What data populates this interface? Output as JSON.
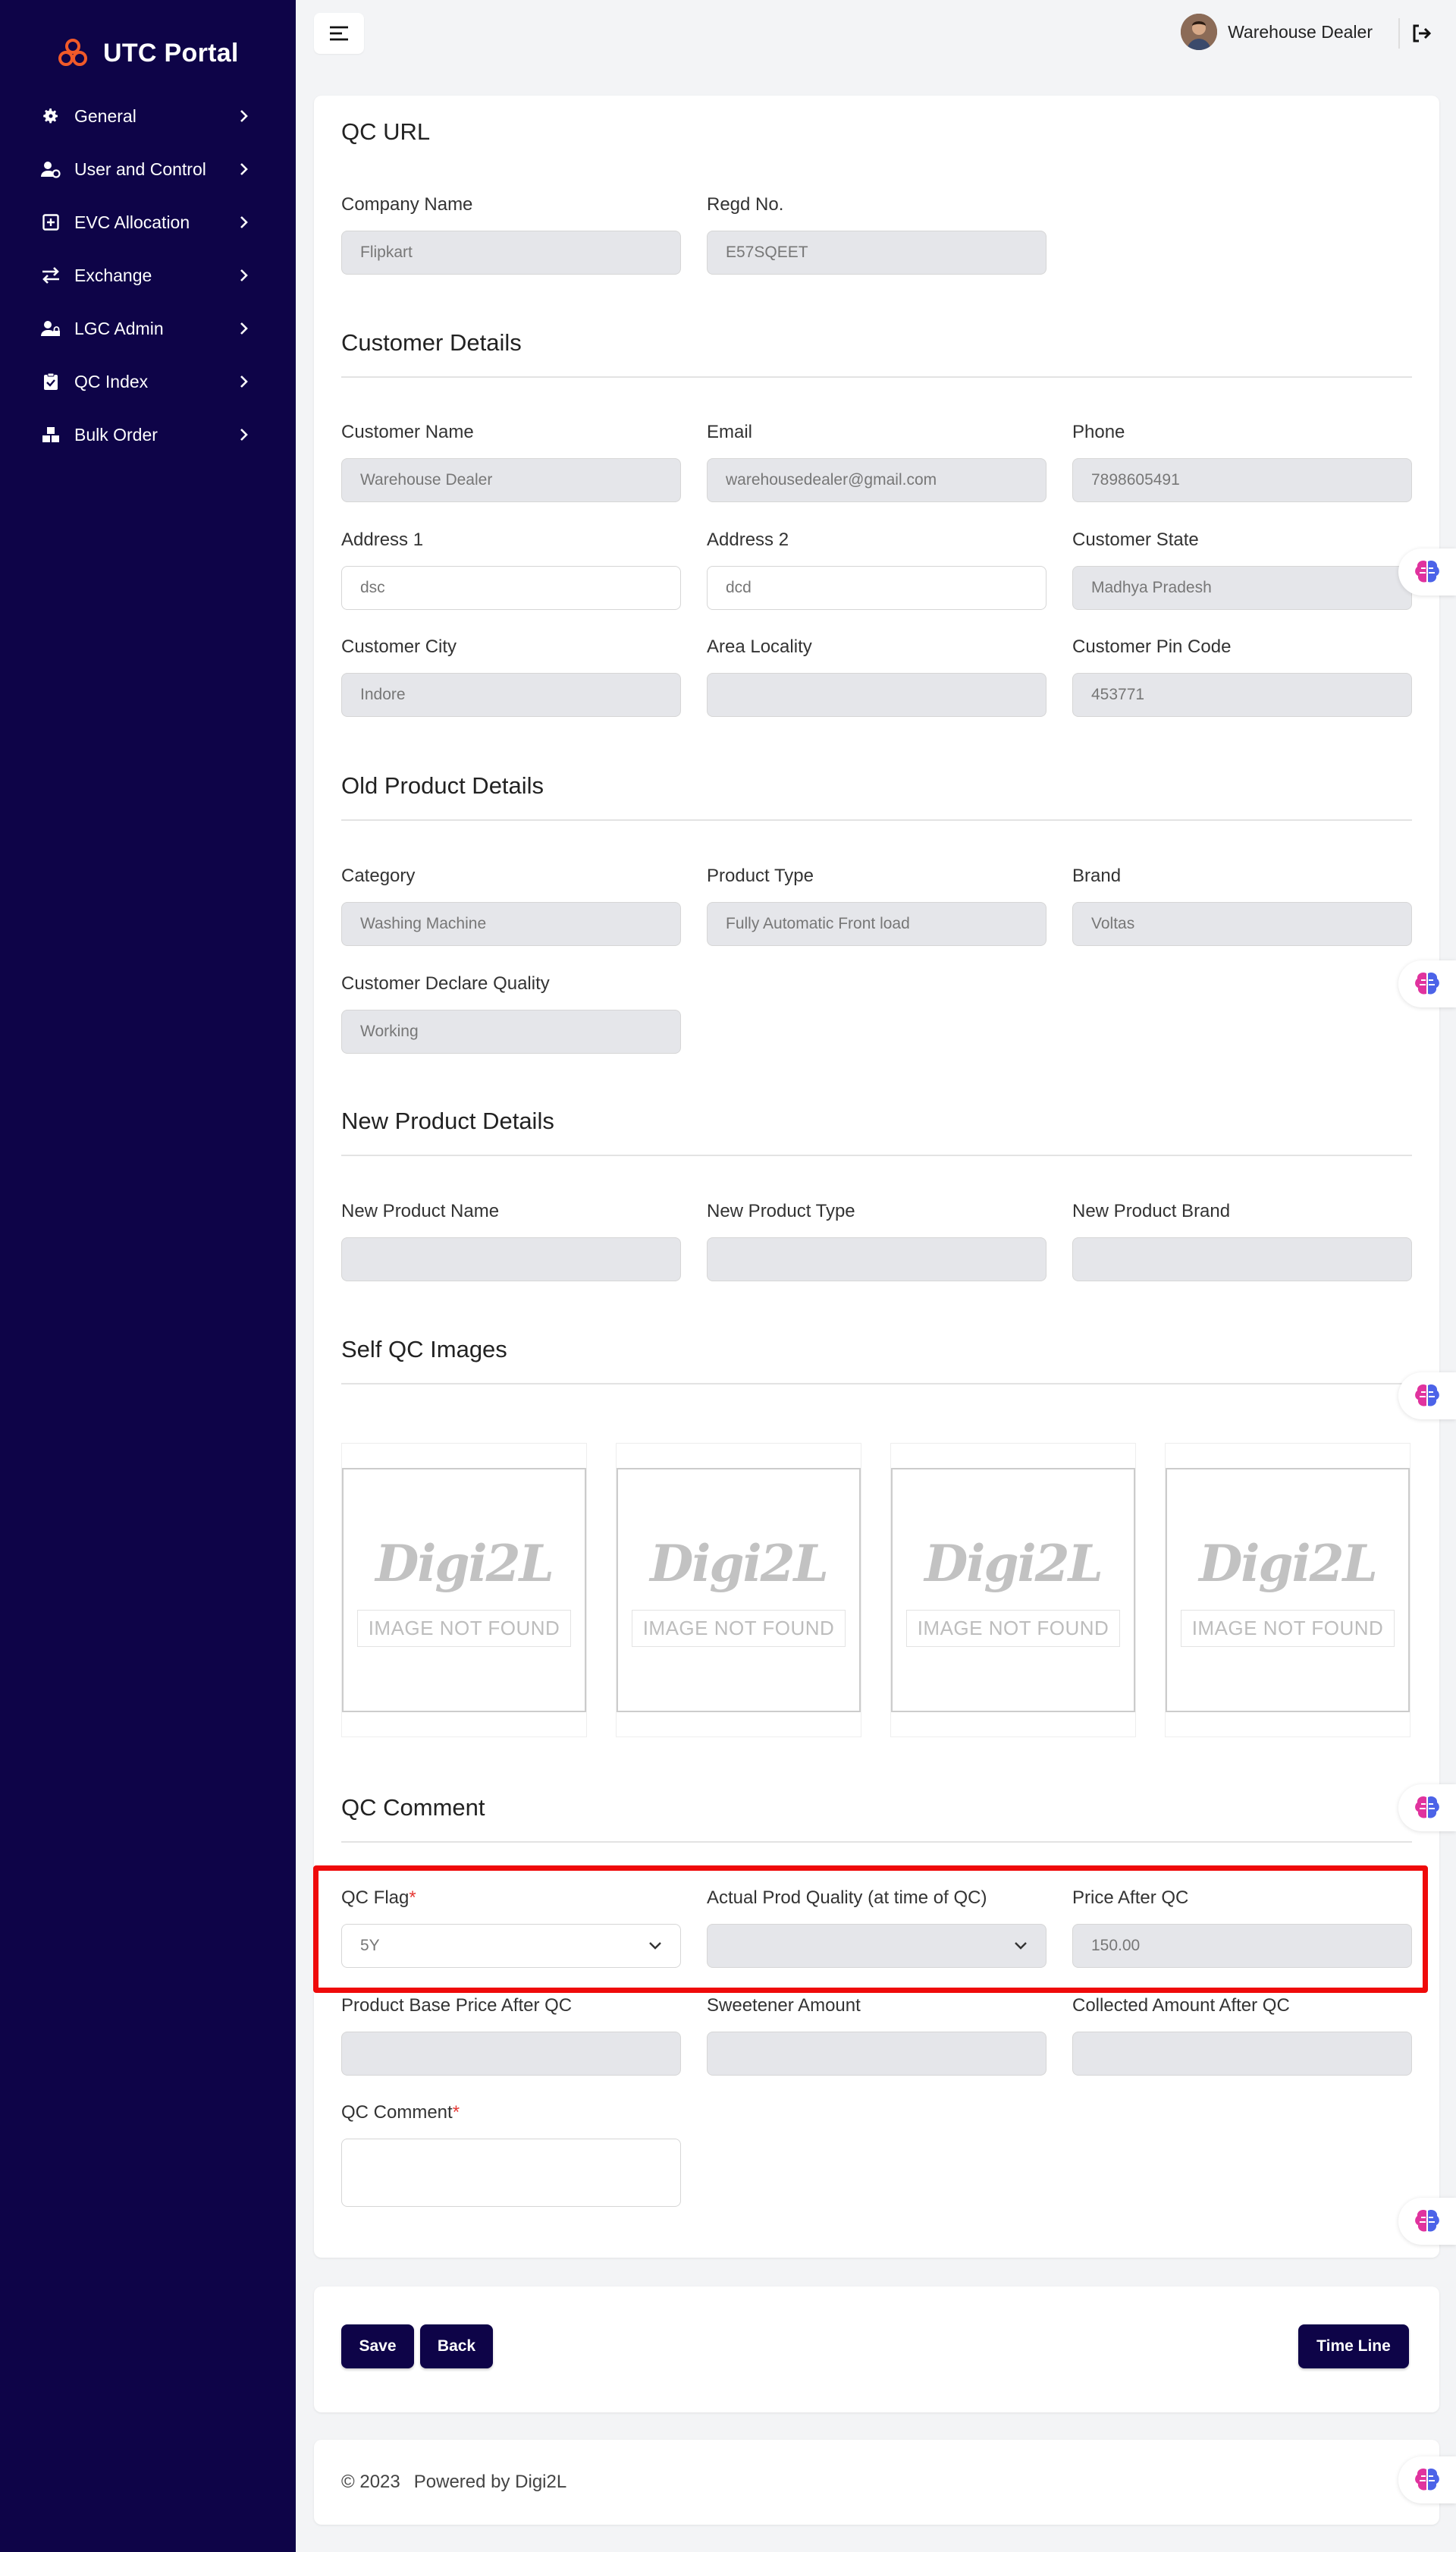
{
  "brand": {
    "name": "UTC Portal"
  },
  "sidebar": {
    "items": [
      {
        "label": "General",
        "icon": "gear-icon"
      },
      {
        "label": "User and Control",
        "icon": "user-gear-icon"
      },
      {
        "label": "EVC Allocation",
        "icon": "plus-square-icon"
      },
      {
        "label": "Exchange",
        "icon": "exchange-arrows-icon"
      },
      {
        "label": "LGC Admin",
        "icon": "user-lock-icon"
      },
      {
        "label": "QC Index",
        "icon": "clipboard-check-icon"
      },
      {
        "label": "Bulk Order",
        "icon": "boxes-icon"
      }
    ]
  },
  "header": {
    "user_name": "Warehouse Dealer"
  },
  "qc_url": {
    "title": "QC URL",
    "company_name": {
      "label": "Company Name",
      "value": "Flipkart"
    },
    "regd_no": {
      "label": "Regd No.",
      "value": "E57SQEET"
    }
  },
  "customer": {
    "title": "Customer Details",
    "name": {
      "label": "Customer Name",
      "value": "Warehouse Dealer"
    },
    "email": {
      "label": "Email",
      "value": "warehousedealer@gmail.com"
    },
    "phone": {
      "label": "Phone",
      "value": "7898605491"
    },
    "address1": {
      "label": "Address 1",
      "value": "dsc"
    },
    "address2": {
      "label": "Address 2",
      "value": "dcd"
    },
    "state": {
      "label": "Customer State",
      "value": "Madhya Pradesh"
    },
    "city": {
      "label": "Customer City",
      "value": "Indore"
    },
    "locality": {
      "label": "Area Locality",
      "value": ""
    },
    "pin": {
      "label": "Customer Pin Code",
      "value": "453771"
    }
  },
  "old_product": {
    "title": "Old Product Details",
    "category": {
      "label": "Category",
      "value": "Washing Machine"
    },
    "type": {
      "label": "Product Type",
      "value": "Fully Automatic Front load"
    },
    "brand": {
      "label": "Brand",
      "value": "Voltas"
    },
    "declared_quality": {
      "label": "Customer Declare Quality",
      "value": "Working"
    }
  },
  "new_product": {
    "title": "New Product Details",
    "name": {
      "label": "New Product Name",
      "value": ""
    },
    "type": {
      "label": "New Product Type",
      "value": ""
    },
    "brand": {
      "label": "New Product Brand",
      "value": ""
    }
  },
  "self_qc": {
    "title": "Self QC Images",
    "placeholder_logo": "Digi2L",
    "placeholder_text": "IMAGE NOT FOUND"
  },
  "qc_comment_section": {
    "title": "QC Comment",
    "qc_flag": {
      "label": "QC Flag",
      "required": "*",
      "value": "5Y"
    },
    "actual_quality": {
      "label": "Actual Prod Quality (at time of QC)",
      "value": ""
    },
    "price_after_qc": {
      "label": "Price After QC",
      "value": "150.00"
    },
    "base_price": {
      "label": "Product Base Price After QC",
      "value": ""
    },
    "sweetener": {
      "label": "Sweetener Amount",
      "value": ""
    },
    "collected": {
      "label": "Collected Amount After QC",
      "value": ""
    },
    "comment": {
      "label": "QC Comment",
      "required": "*",
      "value": ""
    }
  },
  "actions": {
    "save": "Save",
    "back": "Back",
    "timeline": "Time Line"
  },
  "footer": {
    "copyright": "© 2023",
    "powered_by": "Powered by Digi2L"
  },
  "colors": {
    "sidebar": "#0e0448",
    "brand_accent": "#f15a29",
    "highlight": "#ef0a0a",
    "required": "#e53935"
  }
}
